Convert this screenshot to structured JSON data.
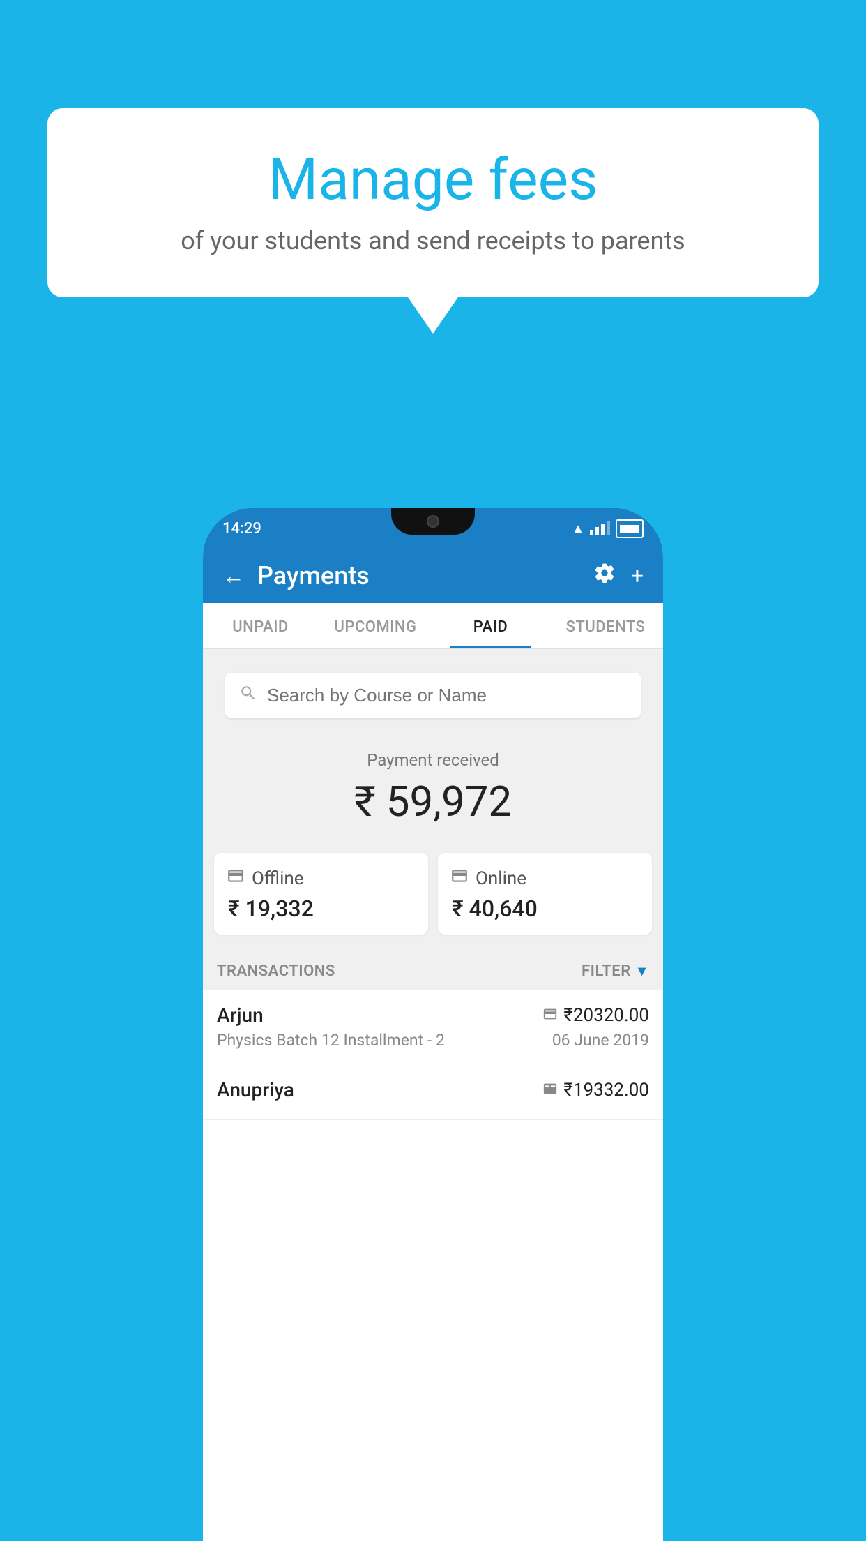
{
  "background_color": "#1ab4e8",
  "speech_bubble": {
    "title": "Manage fees",
    "subtitle": "of your students and send receipts to parents"
  },
  "status_bar": {
    "time": "14:29",
    "wifi_icon": "wifi",
    "signal_icon": "signal",
    "battery_icon": "battery"
  },
  "header": {
    "title": "Payments",
    "back_label": "←",
    "settings_icon": "gear",
    "add_icon": "+"
  },
  "tabs": [
    {
      "label": "UNPAID",
      "active": false
    },
    {
      "label": "UPCOMING",
      "active": false
    },
    {
      "label": "PAID",
      "active": true
    },
    {
      "label": "STUDENTS",
      "active": false
    }
  ],
  "search": {
    "placeholder": "Search by Course or Name"
  },
  "payment_summary": {
    "label": "Payment received",
    "total": "₹ 59,972",
    "offline_label": "Offline",
    "offline_amount": "₹ 19,332",
    "online_label": "Online",
    "online_amount": "₹ 40,640"
  },
  "transactions_section": {
    "label": "TRANSACTIONS",
    "filter_label": "FILTER"
  },
  "transactions": [
    {
      "name": "Arjun",
      "amount": "₹20320.00",
      "detail": "Physics Batch 12 Installment - 2",
      "date": "06 June 2019",
      "payment_type": "card"
    },
    {
      "name": "Anupriya",
      "amount": "₹19332.00",
      "detail": "",
      "date": "",
      "payment_type": "cash"
    }
  ]
}
